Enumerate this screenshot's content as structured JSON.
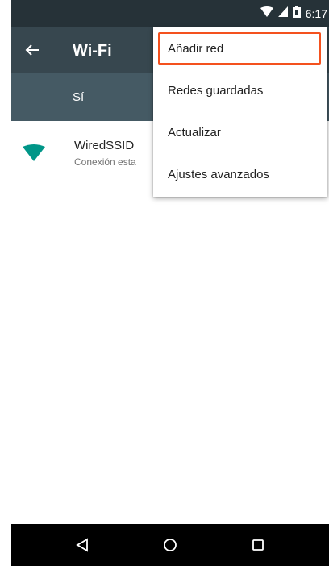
{
  "status_bar": {
    "time": "6:17",
    "icons": [
      "wifi-signal-icon",
      "cell-signal-icon",
      "battery-icon"
    ]
  },
  "toolbar": {
    "title": "Wi-Fi",
    "back_icon": "arrow-back-icon"
  },
  "switch_bar": {
    "label": "Sí"
  },
  "networks": [
    {
      "name": "WiredSSID",
      "status": "Conexión esta",
      "icon": "wifi-full-icon"
    }
  ],
  "menu": {
    "items": [
      {
        "label": "Añadir red",
        "focused": true
      },
      {
        "label": "Redes guardadas",
        "focused": false
      },
      {
        "label": "Actualizar",
        "focused": false
      },
      {
        "label": "Ajustes avanzados",
        "focused": false
      }
    ]
  },
  "nav_bar": {
    "icons": [
      "back-triangle-icon",
      "home-circle-icon",
      "recents-square-icon"
    ]
  },
  "colors": {
    "status_bar": "#263238",
    "toolbar": "#37474f",
    "switch_bar": "#455a64",
    "accent": "#009688",
    "focus_outline": "#f4511e"
  }
}
